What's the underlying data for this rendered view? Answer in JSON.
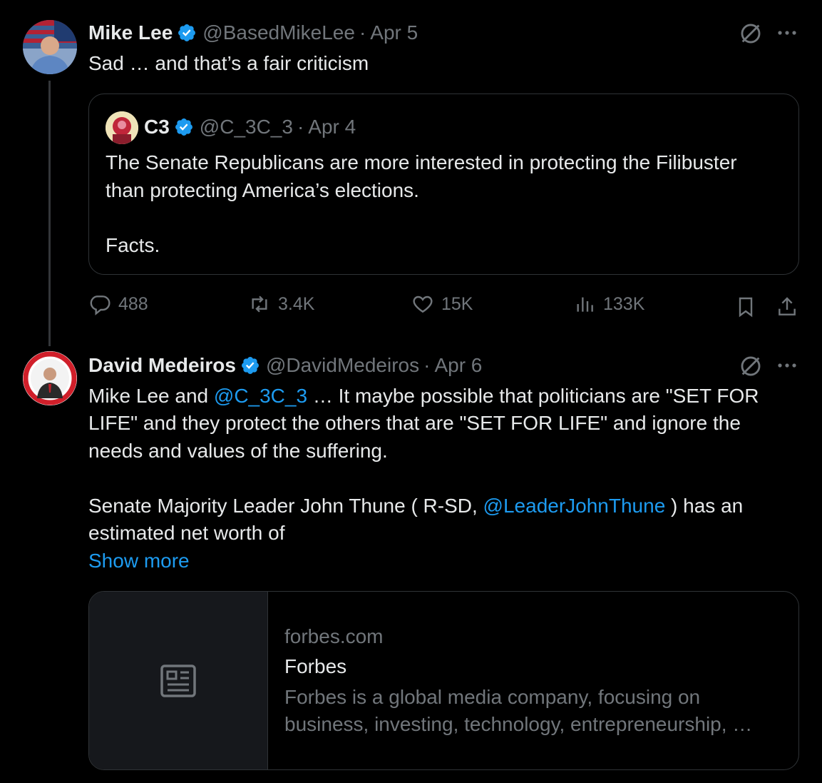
{
  "tweet1": {
    "author_name": "Mike Lee",
    "author_handle": "@BasedMikeLee",
    "separator": "·",
    "date": "Apr 5",
    "text": "Sad … and that’s a fair criticism",
    "icons": [
      "grok-icon",
      "more-icon",
      "verified-icon"
    ],
    "quote": {
      "author_name": "C3",
      "author_handle": "@C_3C_3",
      "separator": "·",
      "date": "Apr 4",
      "line1": "The Senate Republicans are more interested in protecting the Filibuster",
      "line2": "than protecting America’s elections.",
      "line3": "Facts."
    },
    "stats": {
      "replies": "488",
      "reposts": "3.4K",
      "likes": "15K",
      "views": "133K"
    }
  },
  "tweet2": {
    "author_name": "David Medeiros",
    "author_handle": "@DavidMedeiros",
    "separator": "·",
    "date": "Apr 6",
    "line1_prefix": "Mike Lee and ",
    "line1_mention": "@C_3C_3",
    "line1_suffix": " … It maybe possible that politicians are \"SET FOR",
    "line2": "LIFE\" and they protect the others that are \"SET FOR LIFE\" and ignore the",
    "line3": "needs and values of the suffering.",
    "line4_prefix": "Senate Majority Leader John Thune ( R-SD, ",
    "line4_mention": "@LeaderJohnThune",
    "line4_suffix": " ) has an",
    "line5": "estimated net worth of",
    "show_more": "Show more",
    "card": {
      "domain": "forbes.com",
      "title": "Forbes",
      "desc1": "Forbes is a global media company, focusing on",
      "desc2": "business, investing, technology, entrepreneurship, …"
    }
  },
  "colors": {
    "background": "#000000",
    "text": "#e7e9ea",
    "muted": "#71767b",
    "link": "#1d9bf0",
    "verified": "#1d9bf0",
    "border": "#2f3336"
  }
}
